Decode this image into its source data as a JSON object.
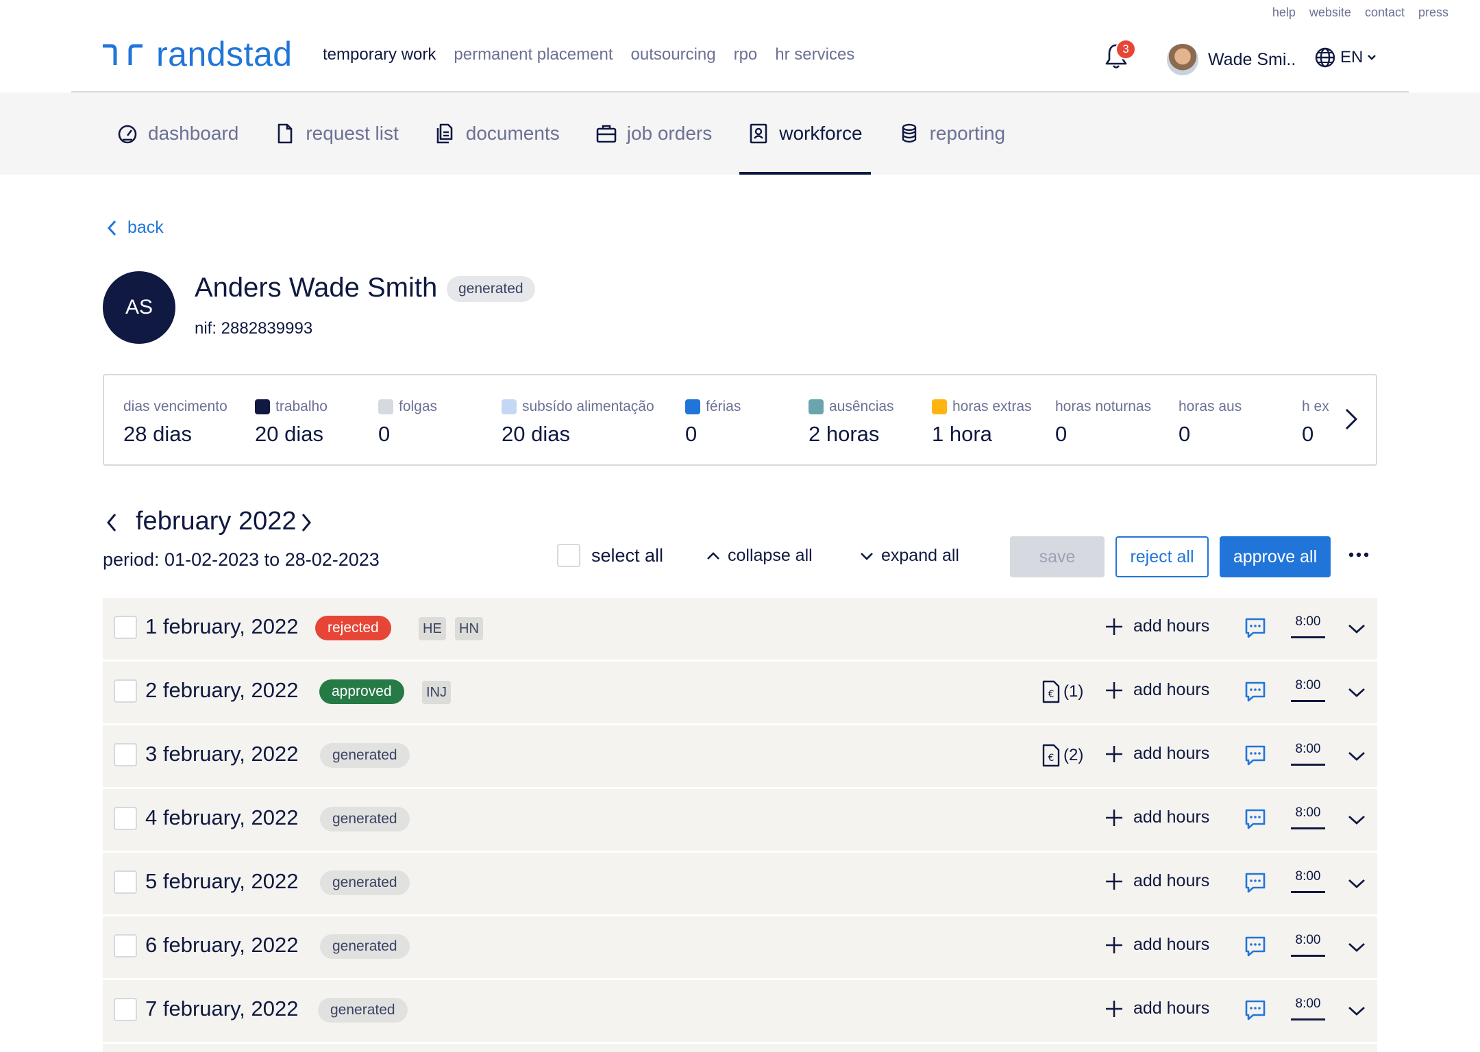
{
  "util_links": [
    "help",
    "website",
    "contact",
    "press"
  ],
  "brand": {
    "name": "randstad",
    "color": "#2175d9"
  },
  "main_nav": [
    {
      "label": "temporary work",
      "active": true
    },
    {
      "label": "permanent placement",
      "active": false
    },
    {
      "label": "outsourcing",
      "active": false
    },
    {
      "label": "rpo",
      "active": false
    },
    {
      "label": "hr services",
      "active": false
    }
  ],
  "notifications": {
    "count": "3",
    "icon": "bell-icon"
  },
  "user": {
    "name": "Wade Smi.."
  },
  "language": {
    "code": "EN",
    "icon": "globe-icon"
  },
  "sub_nav": [
    {
      "label": "dashboard",
      "icon": "gauge-icon",
      "active": false
    },
    {
      "label": "request list",
      "icon": "document-icon",
      "active": false
    },
    {
      "label": "documents",
      "icon": "documents-icon",
      "active": false
    },
    {
      "label": "job orders",
      "icon": "briefcase-icon",
      "active": false
    },
    {
      "label": "workforce",
      "icon": "contact-book-icon",
      "active": true
    },
    {
      "label": "reporting",
      "icon": "database-icon",
      "active": false
    }
  ],
  "back_label": "back",
  "profile": {
    "initials": "AS",
    "name": "Anders Wade Smith",
    "status": "generated",
    "nif": "nif: 2882839993"
  },
  "summary": [
    {
      "label": "dias vencimento",
      "value": "28 dias",
      "color": ""
    },
    {
      "label": "trabalho",
      "value": "20 dias",
      "color": "#0f1941"
    },
    {
      "label": "folgas",
      "value": "0",
      "color": "#d7d9e0"
    },
    {
      "label": "subsído alimentação",
      "value": "20 dias",
      "color": "#c4d8f5"
    },
    {
      "label": "férias",
      "value": "0",
      "color": "#2175d9"
    },
    {
      "label": "ausências",
      "value": "2 horas",
      "color": "#6aa5ad"
    },
    {
      "label": "horas extras",
      "value": "1 hora",
      "color": "#ffb511"
    },
    {
      "label": "horas noturnas",
      "value": "0",
      "color": ""
    },
    {
      "label": "horas aus",
      "value": "0",
      "color": ""
    },
    {
      "label": "h ex",
      "value": "0",
      "color": ""
    }
  ],
  "calendar": {
    "month": "february 2022",
    "period": "period: 01-02-2023 to 28-02-2023",
    "select_all": "select all",
    "collapse_all": "collapse all",
    "expand_all": "expand all",
    "save": "save",
    "reject_all": "reject all",
    "approve_all": "approve all"
  },
  "days": [
    {
      "date": "1 february, 2022",
      "status": "rejected",
      "tags": [
        "HE",
        "HN"
      ],
      "docs": "",
      "add_hours": "add hours",
      "hours": "8:00"
    },
    {
      "date": "2 february, 2022",
      "status": "approved",
      "tags": [
        "INJ"
      ],
      "docs": "(1)",
      "add_hours": "add hours",
      "hours": "8:00"
    },
    {
      "date": "3 february, 2022",
      "status": "generated",
      "tags": [],
      "docs": "(2)",
      "add_hours": "add hours",
      "hours": "8:00"
    },
    {
      "date": "4 february, 2022",
      "status": "generated",
      "tags": [],
      "docs": "",
      "add_hours": "add hours",
      "hours": "8:00"
    },
    {
      "date": "5 february, 2022",
      "status": "generated",
      "tags": [],
      "docs": "",
      "add_hours": "add hours",
      "hours": "8:00"
    },
    {
      "date": "6 february, 2022",
      "status": "generated",
      "tags": [],
      "docs": "",
      "add_hours": "add hours",
      "hours": "8:00"
    },
    {
      "date": "7 february, 2022",
      "status": "generated",
      "tags": [],
      "docs": "",
      "add_hours": "add hours",
      "hours": "8:00"
    }
  ]
}
